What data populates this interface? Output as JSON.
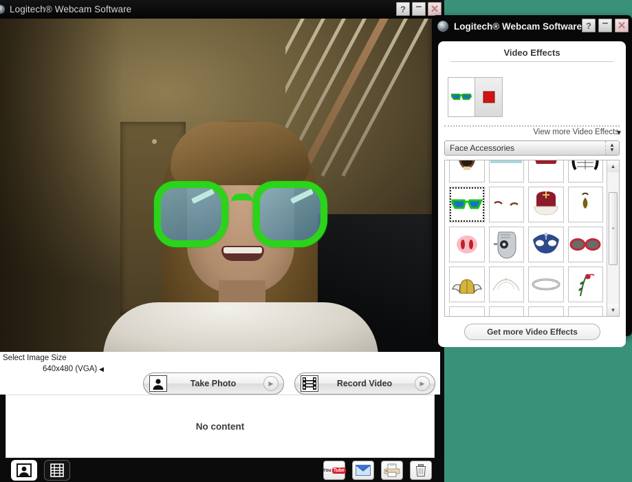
{
  "desktop": {
    "background_color": "#3a9179"
  },
  "main_window": {
    "title": "Logitech® Webcam Software",
    "logo_icon": "logitech-orb-icon",
    "window_buttons": [
      {
        "name": "help-button",
        "label": "?"
      },
      {
        "name": "minimize-button",
        "label": "–"
      },
      {
        "name": "close-button",
        "label": "✕"
      }
    ],
    "video": {
      "description": "Live webcam preview of a smiling woman wearing large green novelty sunglasses overlay, indoor staircase behind"
    },
    "image_size": {
      "label": "Select Image Size",
      "value": "640x480 (VGA)",
      "arrow": "◀"
    },
    "actions": [
      {
        "name": "take-photo-button",
        "label": "Take Photo",
        "icon": "portrait-icon",
        "chevron": "▶"
      },
      {
        "name": "record-video-button",
        "label": "Record Video",
        "icon": "film-strip-icon",
        "chevron": "▶"
      }
    ],
    "gallery": {
      "empty_text": "No content"
    },
    "bottom_tabs": [
      {
        "name": "photos-tab",
        "icon": "photo-icon",
        "active": true
      },
      {
        "name": "videos-tab",
        "icon": "film-icon",
        "active": false
      }
    ],
    "bottom_tools": [
      {
        "name": "youtube-upload-button",
        "icon": "youtube-icon",
        "label_you": "You",
        "label_tube": "Tube"
      },
      {
        "name": "email-button",
        "icon": "envelope-icon"
      },
      {
        "name": "print-button",
        "icon": "printer-icon"
      },
      {
        "name": "delete-button",
        "icon": "trash-icon"
      }
    ]
  },
  "effects_window": {
    "title": "Logitech® Webcam Software",
    "logo_icon": "logitech-orb-icon",
    "window_buttons": [
      {
        "name": "help-button",
        "label": "?"
      },
      {
        "name": "minimize-button",
        "label": "–"
      },
      {
        "name": "close-button",
        "label": "✕"
      }
    ],
    "panel_title": "Video Effects",
    "active_slots": [
      {
        "name": "active-effect-slot",
        "icon": "green-sunglasses-icon"
      },
      {
        "name": "clear-effect-slot",
        "icon": "red-square-icon"
      }
    ],
    "view_more": {
      "label": "View more Video Effects",
      "caret": "▼"
    },
    "category_select": {
      "value": "Face Accessories",
      "spinner_up": "▲",
      "spinner_down": "▼"
    },
    "grid_rows": [
      [
        {
          "name": "effect-beard",
          "icon": "beard-icon"
        },
        {
          "name": "effect-blue-band",
          "icon": "blue-band-icon"
        },
        {
          "name": "effect-teeth",
          "icon": "teeth-icon"
        },
        {
          "name": "effect-helmet-cage",
          "icon": "helmet-cage-icon"
        }
      ],
      [
        {
          "name": "effect-green-sunglasses",
          "icon": "green-sunglasses-icon",
          "selected": true
        },
        {
          "name": "effect-eyebrows",
          "icon": "eyebrows-icon"
        },
        {
          "name": "effect-crown",
          "icon": "royal-crown-icon"
        },
        {
          "name": "effect-goatee",
          "icon": "goatee-icon"
        }
      ],
      [
        {
          "name": "effect-pig-nose",
          "icon": "pig-nose-icon"
        },
        {
          "name": "effect-robot-head",
          "icon": "robot-head-icon"
        },
        {
          "name": "effect-blue-mask",
          "icon": "blue-masquerade-mask-icon"
        },
        {
          "name": "effect-red-sunglasses",
          "icon": "red-sunglasses-icon"
        }
      ],
      [
        {
          "name": "effect-viking-helmet",
          "icon": "viking-helmet-icon"
        },
        {
          "name": "effect-tiara",
          "icon": "tiara-icon"
        },
        {
          "name": "effect-halo",
          "icon": "halo-icon"
        },
        {
          "name": "effect-rose",
          "icon": "rose-icon"
        }
      ],
      [
        {
          "name": "effect-partial-1",
          "icon": "blank-icon"
        },
        {
          "name": "effect-partial-2",
          "icon": "blank-icon"
        },
        {
          "name": "effect-partial-3",
          "icon": "blank-icon"
        },
        {
          "name": "effect-partial-4",
          "icon": "blank-icon"
        }
      ]
    ],
    "scrollbar": {
      "up": "▲",
      "down": "▼",
      "grip": "≡"
    },
    "get_more_button": "Get more Video Effects"
  }
}
